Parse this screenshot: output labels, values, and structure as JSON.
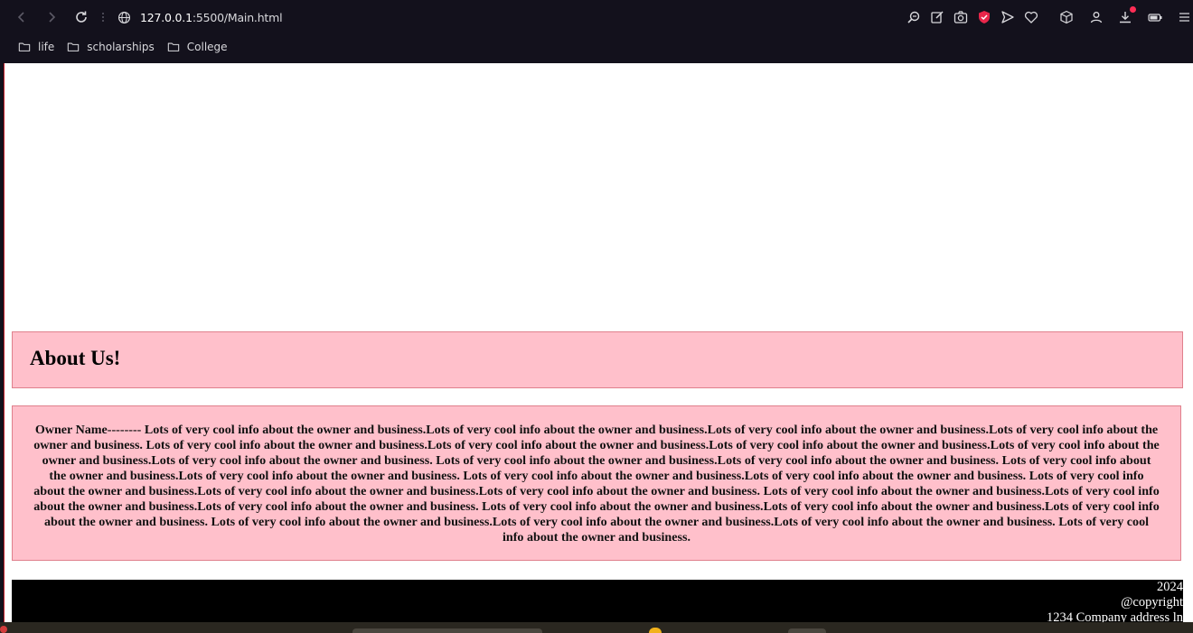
{
  "browser": {
    "url_host": "127.0.0.1",
    "url_rest": ":5500/Main.html",
    "bookmarks": [
      {
        "label": "life"
      },
      {
        "label": "scholarships"
      },
      {
        "label": "College"
      }
    ],
    "toolbar_icons": [
      "back-icon",
      "forward-icon",
      "reload-icon",
      "tabs-icon",
      "site-info-icon",
      "zoom-icon",
      "edit-icon",
      "camera-icon",
      "shield-icon",
      "send-icon",
      "heart-icon",
      "cube-icon",
      "profile-icon",
      "download-icon",
      "battery-icon",
      "menu-icon"
    ]
  },
  "page": {
    "about_heading": "About Us!",
    "about_text": "Owner Name-------- Lots of very cool info about the owner and business.Lots of very cool info about the owner and business.Lots of very cool info about the owner and business.Lots of very cool info about the owner and business. Lots of very cool info about the owner and business.Lots of very cool info about the owner and business.Lots of very cool info about the owner and business.Lots of very cool info about the owner and business.Lots of very cool info about the owner and business. Lots of very cool info about the owner and business.Lots of very cool info about the owner and business. Lots of very cool info about the owner and business.Lots of very cool info about the owner and business. Lots of very cool info about the owner and business.Lots of very cool info about the owner and business. Lots of very cool info about the owner and business.Lots of very cool info about the owner and business.Lots of very cool info about the owner and business. Lots of very cool info about the owner and business.Lots of very cool info about the owner and business.Lots of very cool info about the owner and business. Lots of very cool info about the owner and business.Lots of very cool info about the owner and business.Lots of very cool info about the owner and business. Lots of very cool info about the owner and business.Lots of very cool info about the owner and business.Lots of very cool info about the owner and business. Lots of very cool info about the owner and business.",
    "footer": {
      "year": "2024",
      "copyright": "@copyright",
      "address": "1234 Company address ln"
    }
  },
  "colors": {
    "chrome_bg": "#13111c",
    "section_bg": "#ffc0cb",
    "footer_bg": "#000000",
    "accent_red": "#e8264a"
  }
}
